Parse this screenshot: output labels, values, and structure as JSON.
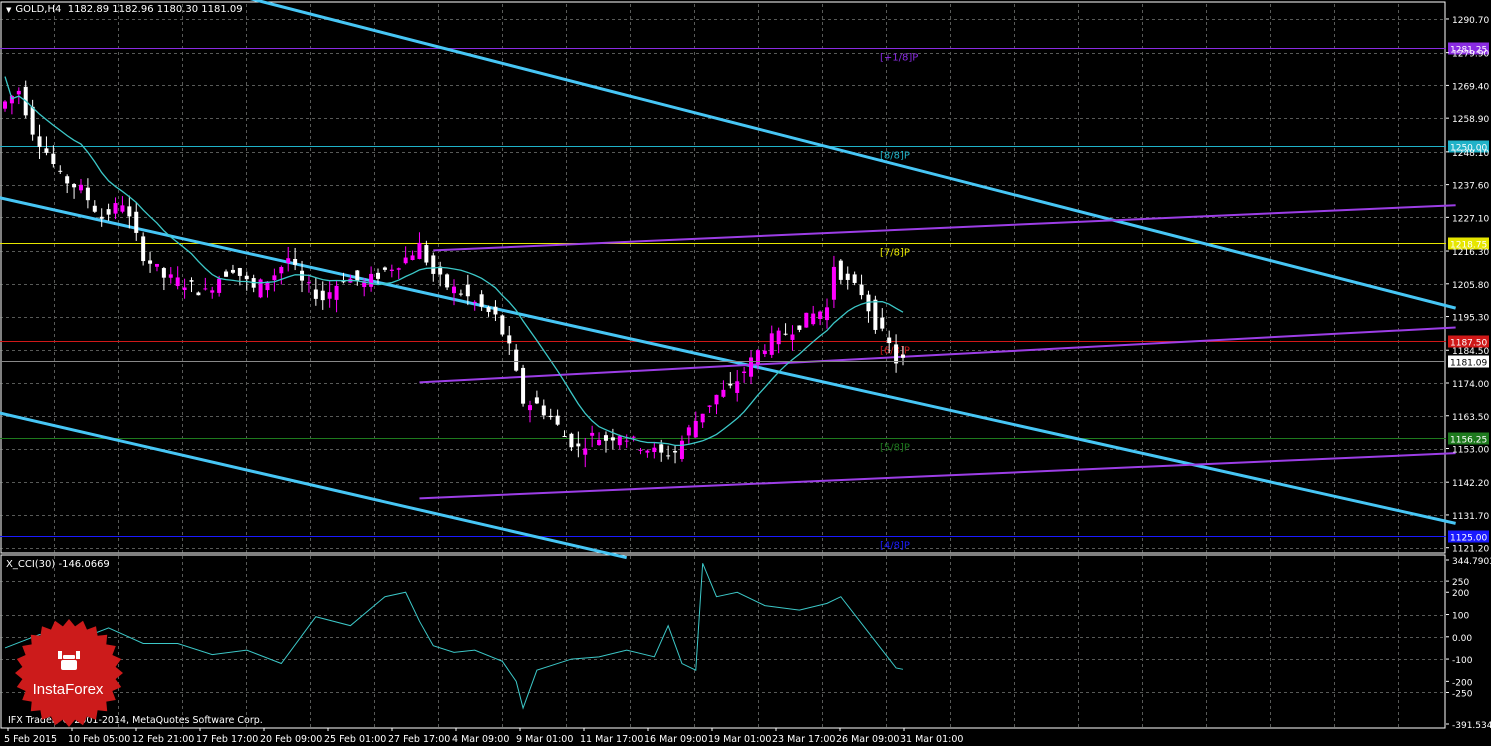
{
  "header": {
    "symbol": "GOLD,H4",
    "ohlc": "1182.89 1182.96 1180.30 1181.09"
  },
  "indicator": {
    "label": "X_CCI(30) -146.0669",
    "price_ticks": [
      "344.7903",
      "250",
      "200",
      "100",
      "0.00",
      "-100",
      "-200",
      "-250",
      "-391.534"
    ]
  },
  "copyright": "IFX Trader, © 2001-2014, MetaQuotes Software Corp.",
  "logo": {
    "text": "InstaForex",
    "color": "#cc1b1b"
  },
  "colors": {
    "background": "#000000",
    "grid": "#a0a4a0",
    "bull_candle": "#ff00ff",
    "bear_candle": "#ffffff",
    "moving_average": "#3cc8c8",
    "channel": "#47c6f5",
    "trend": "#9c3ee6",
    "cci": "#3cc8c8"
  },
  "chart_data": {
    "type": "candlestick",
    "symbol": "GOLD",
    "timeframe": "H4",
    "last_price": "1181.09",
    "y_axis_ticks": [
      "1290.70",
      "1279.90",
      "1269.40",
      "1258.90",
      "1248.10",
      "1237.60",
      "1227.10",
      "1216.30",
      "1205.80",
      "1195.30",
      "1184.50",
      "1174.00",
      "1163.50",
      "1153.00",
      "1142.20",
      "1131.70",
      "1121.20"
    ],
    "ylim": [
      1119.5,
      1295.5
    ],
    "x_axis_labels": [
      "5 Feb 2015",
      "10 Feb 05:00",
      "12 Feb 21:00",
      "17 Feb 17:00",
      "20 Feb 09:00",
      "25 Feb 01:00",
      "27 Feb 17:00",
      "4 Mar 09:00",
      "9 Mar 01:00",
      "11 Mar 17:00",
      "16 Mar 09:00",
      "19 Mar 01:00",
      "23 Mar 17:00",
      "26 Mar 09:00",
      "31 Mar 01:00"
    ],
    "murrey_levels": [
      {
        "value": 1281.25,
        "label": "[+1/8]P",
        "box": "1281.25",
        "color": "#8a2be2"
      },
      {
        "value": 1250.0,
        "label": "[8/8]P",
        "box": "1250.00",
        "color": "#20b2c8"
      },
      {
        "value": 1218.75,
        "label": "[7/8]P",
        "box": "1218.75",
        "color": "#e6e600"
      },
      {
        "value": 1187.5,
        "label": "[6/8]P",
        "box": "1187.50",
        "color": "#d01818"
      },
      {
        "value": 1156.25,
        "label": "[5/8]P",
        "box": "1156.25",
        "color": "#1e7a1e"
      },
      {
        "value": 1125.0,
        "label": "[4/8]P",
        "box": "1125.00",
        "color": "#1a1aff"
      }
    ],
    "price_path": [
      [
        0,
        1262
      ],
      [
        3,
        1268
      ],
      [
        5,
        1255
      ],
      [
        7,
        1248
      ],
      [
        9,
        1240
      ],
      [
        12,
        1236
      ],
      [
        15,
        1227
      ],
      [
        18,
        1232
      ],
      [
        21,
        1215
      ],
      [
        24,
        1208
      ],
      [
        27,
        1206
      ],
      [
        30,
        1203
      ],
      [
        32,
        1208
      ],
      [
        34,
        1211
      ],
      [
        37,
        1204
      ],
      [
        40,
        1209
      ],
      [
        42,
        1214
      ],
      [
        44,
        1206
      ],
      [
        47,
        1201
      ],
      [
        50,
        1208
      ],
      [
        53,
        1206
      ],
      [
        56,
        1210
      ],
      [
        59,
        1214
      ],
      [
        61,
        1218
      ],
      [
        63,
        1209
      ],
      [
        65,
        1205
      ],
      [
        67,
        1203
      ],
      [
        70,
        1198
      ],
      [
        72,
        1195
      ],
      [
        74,
        1185
      ],
      [
        76,
        1168
      ],
      [
        78,
        1167
      ],
      [
        80,
        1163
      ],
      [
        82,
        1157
      ],
      [
        84,
        1153
      ],
      [
        86,
        1157
      ],
      [
        88,
        1156
      ],
      [
        90,
        1158
      ],
      [
        92,
        1155
      ],
      [
        94,
        1153
      ],
      [
        96,
        1151
      ],
      [
        98,
        1152
      ],
      [
        100,
        1159
      ],
      [
        102,
        1165
      ],
      [
        104,
        1170
      ],
      [
        106,
        1172
      ],
      [
        108,
        1178
      ],
      [
        110,
        1184
      ],
      [
        112,
        1188
      ],
      [
        114,
        1190
      ],
      [
        116,
        1193
      ],
      [
        118,
        1196
      ],
      [
        120,
        1198
      ],
      [
        121,
        1212
      ],
      [
        123,
        1206
      ],
      [
        125,
        1203
      ],
      [
        127,
        1193
      ],
      [
        129,
        1186
      ],
      [
        130,
        1181.09
      ]
    ],
    "cci_path": [
      [
        0,
        -50
      ],
      [
        5,
        10
      ],
      [
        10,
        -20
      ],
      [
        15,
        40
      ],
      [
        20,
        -30
      ],
      [
        25,
        -30
      ],
      [
        30,
        -80
      ],
      [
        35,
        -60
      ],
      [
        40,
        -120
      ],
      [
        45,
        90
      ],
      [
        50,
        50
      ],
      [
        55,
        180
      ],
      [
        58,
        200
      ],
      [
        60,
        70
      ],
      [
        62,
        -40
      ],
      [
        65,
        -70
      ],
      [
        68,
        -60
      ],
      [
        72,
        -110
      ],
      [
        74,
        -200
      ],
      [
        75,
        -320
      ],
      [
        77,
        -150
      ],
      [
        82,
        -100
      ],
      [
        86,
        -90
      ],
      [
        90,
        -60
      ],
      [
        94,
        -90
      ],
      [
        96,
        50
      ],
      [
        98,
        -120
      ],
      [
        100,
        -150
      ],
      [
        101,
        330
      ],
      [
        103,
        180
      ],
      [
        106,
        200
      ],
      [
        110,
        140
      ],
      [
        115,
        120
      ],
      [
        119,
        150
      ],
      [
        121,
        180
      ],
      [
        124,
        60
      ],
      [
        127,
        -60
      ],
      [
        129,
        -140
      ],
      [
        130,
        -146
      ]
    ],
    "cci_ylim": [
      -391.534,
      344.7903
    ]
  }
}
